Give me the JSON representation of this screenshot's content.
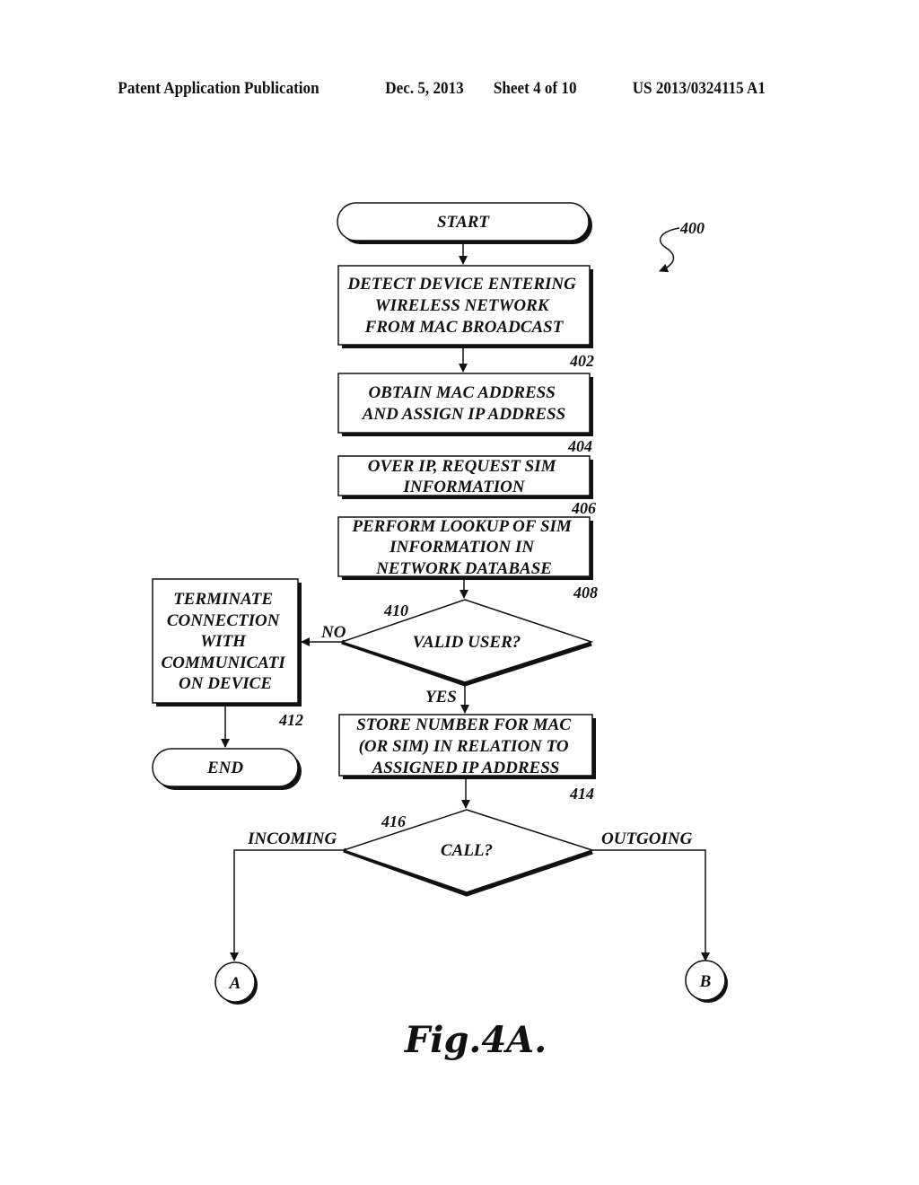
{
  "header": {
    "publication": "Patent Application Publication",
    "date": "Dec. 5, 2013",
    "sheet": "Sheet 4 of 10",
    "number": "US 2013/0324115 A1"
  },
  "diagram": {
    "ref_number": "400",
    "start": "START",
    "end": "END",
    "steps": [
      {
        "id": "402",
        "lines": [
          "DETECT DEVICE ENTERING",
          "WIRELESS NETWORK",
          "FROM MAC BROADCAST"
        ]
      },
      {
        "id": "404",
        "lines": [
          "OBTAIN MAC ADDRESS",
          "AND ASSIGN IP ADDRESS"
        ]
      },
      {
        "id": "406",
        "lines": [
          "OVER IP, REQUEST SIM",
          "INFORMATION"
        ]
      },
      {
        "id": "408",
        "lines": [
          "PERFORM LOOKUP OF SIM",
          "INFORMATION IN",
          "NETWORK DATABASE"
        ]
      },
      {
        "id": "412",
        "lines": [
          "TERMINATE",
          "CONNECTION",
          "WITH",
          "COMMUNICATI",
          "ON DEVICE"
        ]
      },
      {
        "id": "414",
        "lines": [
          "STORE NUMBER FOR MAC",
          "(OR SIM) IN RELATION TO",
          "ASSIGNED IP ADDRESS"
        ]
      }
    ],
    "decisions": [
      {
        "id": "410",
        "text": "VALID USER?",
        "no_label": "NO",
        "yes_label": "YES"
      },
      {
        "id": "416",
        "text": "CALL?",
        "left_label": "INCOMING",
        "right_label": "OUTGOING"
      }
    ],
    "connectors": [
      "A",
      "B"
    ],
    "caption": "Fig.4A."
  }
}
